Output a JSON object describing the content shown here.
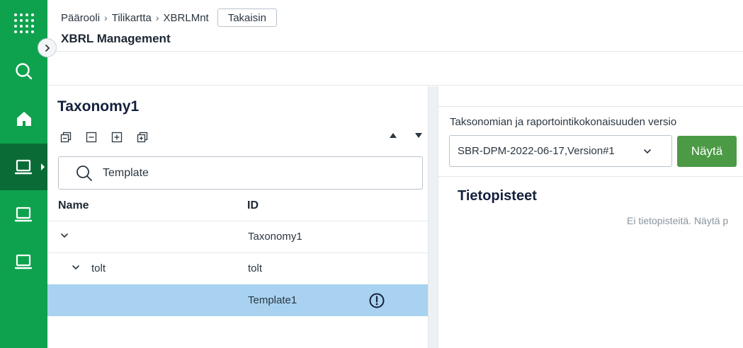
{
  "sidebar": {
    "items": [
      {
        "icon": "apps-grid-icon"
      },
      {
        "icon": "search-icon"
      },
      {
        "icon": "home-icon"
      },
      {
        "icon": "laptop-icon",
        "active": true
      },
      {
        "icon": "laptop-icon"
      },
      {
        "icon": "laptop-icon"
      }
    ],
    "brand_color": "#0fa24e",
    "active_color": "#0b6b36"
  },
  "header": {
    "breadcrumb": [
      "Päärooli",
      "Tilikartta",
      "XBRLMnt"
    ],
    "back_label": "Takaisin",
    "title": "XBRL Management"
  },
  "tree_panel": {
    "title": "Taxonomy1",
    "search": {
      "value": "Template"
    },
    "columns": {
      "name": "Name",
      "id": "ID"
    },
    "rows": [
      {
        "name": "",
        "id": "Taxonomy1",
        "level": 0,
        "expanded": true
      },
      {
        "name": "tolt",
        "id": "tolt",
        "level": 1,
        "expanded": true
      },
      {
        "name": "",
        "id": "Template1",
        "level": 2,
        "selected": true,
        "warning": true
      }
    ],
    "selected_color": "#a8d2f0"
  },
  "detail_panel": {
    "version_label": "Taksonomian ja raportointikokonaisuuden versio",
    "version_value": "SBR-DPM-2022-06-17,Version#1",
    "show_label": "Näytä",
    "show_color": "#4c9a45",
    "section_title": "Tietopisteet",
    "empty_message": "Ei tietopisteitä. Näytä p"
  }
}
